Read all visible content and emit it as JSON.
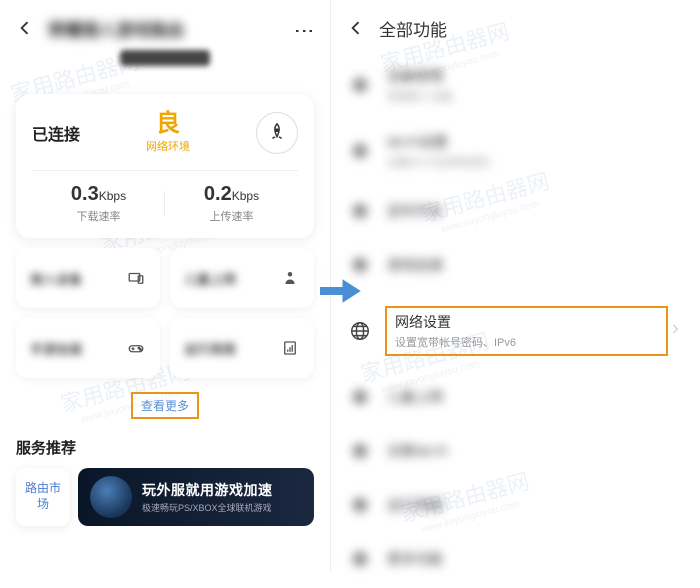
{
  "left": {
    "header_title": "荣耀猎人游戏路由",
    "status": {
      "connected": "已连接",
      "quality_big": "良",
      "quality_small": "网络环境"
    },
    "speed": {
      "down_value": "0.3",
      "down_unit": "Kbps",
      "down_label": "下载速率",
      "up_value": "0.2",
      "up_unit": "Kbps",
      "up_label": "上传速率"
    },
    "features": [
      {
        "title": "接入设备",
        "sub": ""
      },
      {
        "title": "儿童上网",
        "sub": ""
      },
      {
        "title": "手游加速",
        "sub": ""
      },
      {
        "title": "运行周报",
        "sub": ""
      }
    ],
    "see_more": "查看更多",
    "recommend_title": "服务推荐",
    "market_btn": "路由市场",
    "banner_title": "玩外服就用游戏加速",
    "banner_sub": "极速畅玩PS/XBOX全球联机游戏"
  },
  "right": {
    "header_title": "全部功能",
    "highlighted": {
      "title": "网络设置",
      "sub": "设置宽带帐号密码、IPv6"
    },
    "blur_items": [
      {
        "title": "设备管理",
        "sub": "管理接入设备"
      },
      {
        "title": "Wi-Fi设置",
        "sub": "设置Wi-Fi名称和密码"
      },
      {
        "title": "定时开关",
        "sub": ""
      },
      {
        "title": "游戏加速",
        "sub": ""
      },
      {
        "title": "儿童上网",
        "sub": ""
      },
      {
        "title": "访客Wi-Fi",
        "sub": ""
      },
      {
        "title": "运行周报",
        "sub": ""
      },
      {
        "title": "更多功能",
        "sub": ""
      }
    ]
  }
}
